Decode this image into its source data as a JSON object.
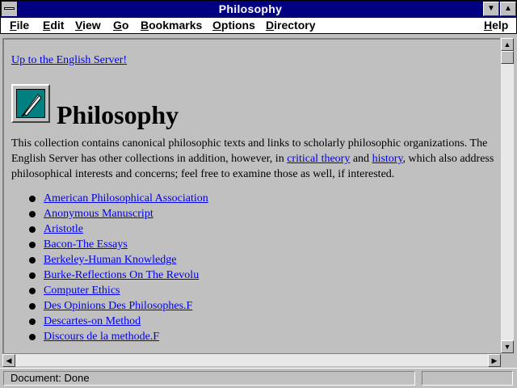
{
  "window": {
    "title": "Philosophy"
  },
  "menubar": {
    "items": [
      {
        "accel": "F",
        "rest": "ile"
      },
      {
        "accel": "E",
        "rest": "dit"
      },
      {
        "accel": "V",
        "rest": "iew"
      },
      {
        "accel": "G",
        "rest": "o"
      },
      {
        "accel": "B",
        "rest": "ookmarks"
      },
      {
        "accel": "O",
        "rest": "ptions"
      },
      {
        "accel": "D",
        "rest": "irectory"
      },
      {
        "accel": "H",
        "rest": "elp"
      }
    ]
  },
  "page": {
    "up_link": "Up to the English Server!",
    "heading": "Philosophy",
    "intro_part1": "This collection contains canonical philosophic texts and links to scholarly philosophic organizations. The English Server has other collections in addition, however, in ",
    "intro_link1": "critical theory",
    "intro_part2": " and ",
    "intro_link2": "history",
    "intro_part3": ", which also address philosophical interests and concerns; feel free to examine those as well, if interested.",
    "links": [
      "American Philosophical Association",
      "Anonymous Manuscript",
      "Aristotle",
      "Bacon-The Essays",
      "Berkeley-Human Knowledge",
      "Burke-Reflections On The Revolu",
      "Computer Ethics",
      "Des Opinions Des Philosophes.F",
      "Descartes-on Method",
      "Discours de la methode.F"
    ]
  },
  "statusbar": {
    "text": "Document: Done"
  },
  "icons": {
    "system_menu": "system-menu-icon",
    "minimize": "minimize-icon",
    "maximize": "maximize-icon",
    "logo": "quill-icon"
  }
}
